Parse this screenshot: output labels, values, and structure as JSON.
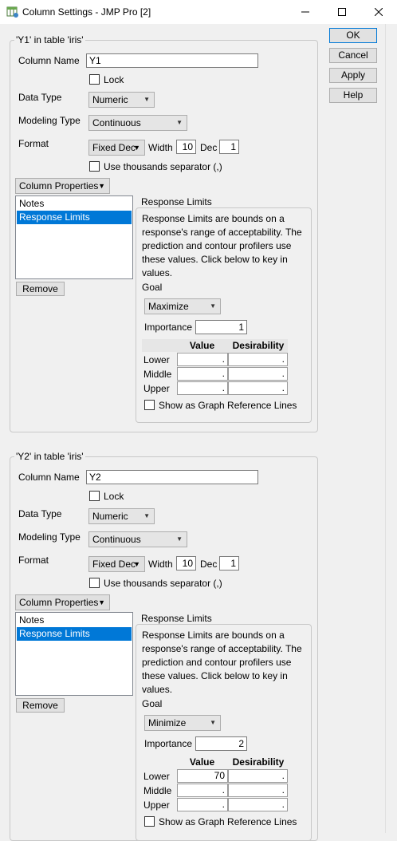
{
  "window": {
    "title": "Column Settings - JMP Pro [2]"
  },
  "buttons": {
    "ok": "OK",
    "cancel": "Cancel",
    "apply": "Apply",
    "help": "Help"
  },
  "columns": [
    {
      "legend": "'Y1' in table 'iris'",
      "column_name_label": "Column Name",
      "column_name": "Y1",
      "lock_label": "Lock",
      "data_type_label": "Data Type",
      "data_type": "Numeric",
      "modeling_type_label": "Modeling Type",
      "modeling_type": "Continuous",
      "format_label": "Format",
      "format": "Fixed Dec",
      "width_label": "Width",
      "width": "10",
      "dec_label": "Dec",
      "dec": "1",
      "thousands_label": "Use thousands separator (,)",
      "column_properties_label": "Column Properties",
      "properties": [
        "Notes",
        "Response Limits"
      ],
      "remove_label": "Remove",
      "response_limits": {
        "legend": "Response Limits",
        "desc_lines": [
          "Response Limits are bounds on a",
          "response's range of acceptability. The",
          "prediction and contour profilers use",
          "these values. Click below to key in",
          "values."
        ],
        "goal_label": "Goal",
        "goal": "Maximize",
        "importance_label": "Importance",
        "importance": "1",
        "value_header": "Value",
        "desirability_header": "Desirability",
        "rows": [
          {
            "label": "Lower",
            "value": ".",
            "desirability": "."
          },
          {
            "label": "Middle",
            "value": ".",
            "desirability": "."
          },
          {
            "label": "Upper",
            "value": ".",
            "desirability": "."
          }
        ],
        "graph_ref_label": "Show as Graph Reference Lines"
      }
    },
    {
      "legend": "'Y2' in table 'iris'",
      "column_name_label": "Column Name",
      "column_name": "Y2",
      "lock_label": "Lock",
      "data_type_label": "Data Type",
      "data_type": "Numeric",
      "modeling_type_label": "Modeling Type",
      "modeling_type": "Continuous",
      "format_label": "Format",
      "format": "Fixed Dec",
      "width_label": "Width",
      "width": "10",
      "dec_label": "Dec",
      "dec": "1",
      "thousands_label": "Use thousands separator (,)",
      "column_properties_label": "Column Properties",
      "properties": [
        "Notes",
        "Response Limits"
      ],
      "remove_label": "Remove",
      "response_limits": {
        "legend": "Response Limits",
        "desc_lines": [
          "Response Limits are bounds on a",
          "response's range of acceptability. The",
          "prediction and contour profilers use",
          "these values. Click below to key in",
          "values."
        ],
        "goal_label": "Goal",
        "goal": "Minimize",
        "importance_label": "Importance",
        "importance": "2",
        "value_header": "Value",
        "desirability_header": "Desirability",
        "rows": [
          {
            "label": "Lower",
            "value": "70",
            "desirability": "."
          },
          {
            "label": "Middle",
            "value": ".",
            "desirability": "."
          },
          {
            "label": "Upper",
            "value": ".",
            "desirability": "."
          }
        ],
        "graph_ref_label": "Show as Graph Reference Lines"
      }
    }
  ]
}
